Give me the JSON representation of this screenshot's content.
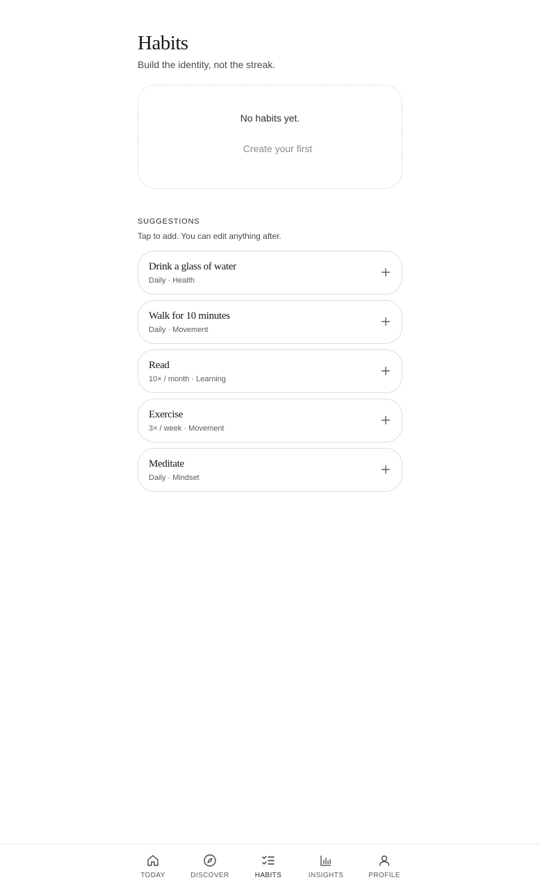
{
  "header": {
    "title": "Habits",
    "subtitle": "Build the identity, not the streak."
  },
  "empty_state": {
    "title": "No habits yet.",
    "cta": "Create your first"
  },
  "suggestions": {
    "label": "SUGGESTIONS",
    "hint": "Tap to add. You can edit anything after.",
    "items": [
      {
        "title": "Drink a glass of water",
        "meta": "Daily · Health",
        "icon": "plus-icon"
      },
      {
        "title": "Walk for 10 minutes",
        "meta": "Daily · Movement",
        "icon": "plus-icon"
      },
      {
        "title": "Read",
        "meta": "10× / month · Learning",
        "icon": "plus-icon"
      },
      {
        "title": "Exercise",
        "meta": "3× / week · Movement",
        "icon": "plus-icon"
      },
      {
        "title": "Meditate",
        "meta": "Daily · Mindset",
        "icon": "plus-icon"
      }
    ]
  },
  "nav": {
    "active": "HABITS",
    "items": [
      {
        "label": "TODAY",
        "icon": "home-icon"
      },
      {
        "label": "DISCOVER",
        "icon": "compass-icon"
      },
      {
        "label": "HABITS",
        "icon": "checklist-icon"
      },
      {
        "label": "INSIGHTS",
        "icon": "bar-chart-icon"
      },
      {
        "label": "PROFILE",
        "icon": "user-icon"
      }
    ]
  },
  "colors": {
    "text": "#161616",
    "muted": "#8a8a8a",
    "border": "#dedede"
  }
}
